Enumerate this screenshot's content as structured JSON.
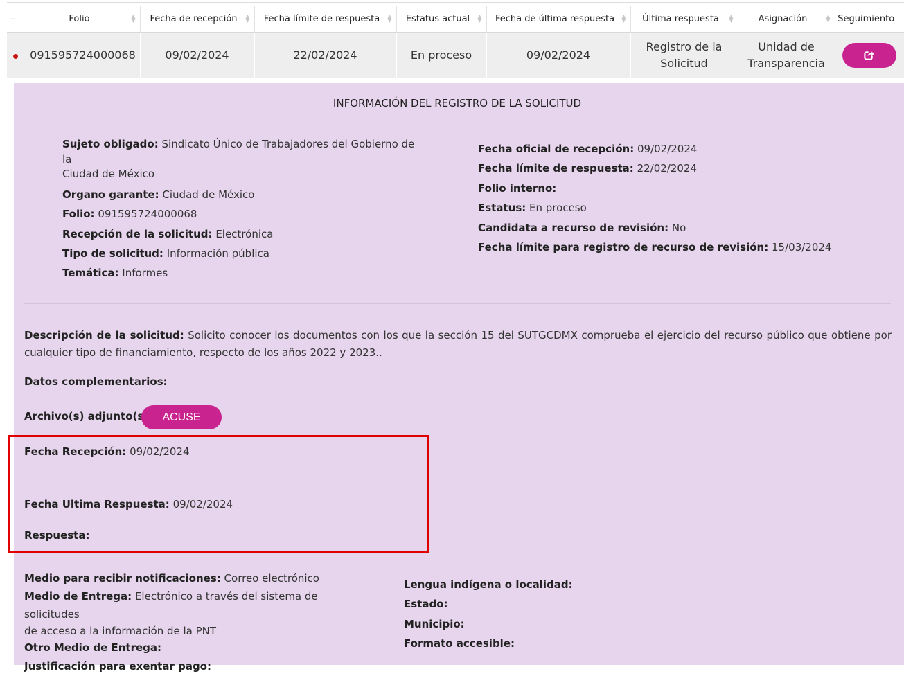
{
  "table": {
    "headers": [
      "--",
      "Folio",
      "Fecha de recepción",
      "Fecha límite de respuesta",
      "Estatus actual",
      "Fecha de última respuesta",
      "Última respuesta",
      "Asignación",
      "Seguimiento"
    ],
    "row": {
      "folio": "091595724000068",
      "fecha_recepcion": "09/02/2024",
      "fecha_limite": "22/02/2024",
      "estatus": "En proceso",
      "fecha_ultima": "09/02/2024",
      "ultima_respuesta_1": "Registro de la",
      "ultima_respuesta_2": "Solicitud",
      "asignacion_1": "Unidad de",
      "asignacion_2": "Transparencia",
      "seguimiento_icon": "external-link-icon"
    }
  },
  "panel": {
    "title": "INFORMACIÓN DEL REGISTRO DE LA SOLICITUD",
    "left": [
      {
        "label": "Sujeto obligado:",
        "value": "Sindicato Único de Trabajadores del Gobierno de la"
      },
      {
        "label": "",
        "value": "Ciudad de México"
      },
      {
        "label": "Organo garante:",
        "value": "Ciudad de México"
      },
      {
        "label": "Folio:",
        "value": "091595724000068"
      },
      {
        "label": "Recepción de la solicitud:",
        "value": "Electrónica"
      },
      {
        "label": "Tipo de solicitud:",
        "value": "Información pública"
      },
      {
        "label": "Temática:",
        "value": "Informes"
      }
    ],
    "right": [
      {
        "label": "Fecha oficial de recepción:",
        "value": "09/02/2024"
      },
      {
        "label": "Fecha límite de respuesta:",
        "value": "22/02/2024"
      },
      {
        "label": "Folio interno:",
        "value": ""
      },
      {
        "label": "Estatus:",
        "value": "En proceso"
      },
      {
        "label": "Candidata a recurso de revisión:",
        "value": "No"
      },
      {
        "label": "Fecha límite para registro de recurso de revisión:",
        "value": "15/03/2024"
      }
    ],
    "descripcion_label": "Descripción de la solicitud:",
    "descripcion_line1": "Solicito conocer los documentos con los que la sección 15 del SUTGCDMX comprueba el ejercicio del recurso público que obtiene por",
    "descripcion_line2": "cualquier tipo de financiamiento, respecto de los años 2022 y 2023..",
    "datos_label": "Datos complementarios:",
    "archivos_label": "Archivo(s) adjunto(s):",
    "acuse_button": "ACUSE",
    "fecha_recepcion_label": "Fecha Recepción:",
    "fecha_recepcion_value": "09/02/2024",
    "fecha_ultima_label": "Fecha Ultima Respuesta:",
    "fecha_ultima_value": "09/02/2024",
    "respuesta_label": "Respuesta:",
    "bottom_left": [
      {
        "label": "Medio para recibir notificaciones:",
        "value": "Correo electrónico"
      },
      {
        "label": "Medio de Entrega:",
        "value": "Electrónico a través del sistema de solicitudes"
      },
      {
        "label": "",
        "value": "de acceso a la información de la PNT"
      },
      {
        "label": "Otro Medio de Entrega:",
        "value": ""
      },
      {
        "label": "Justificación para exentar pago:",
        "value": ""
      }
    ],
    "bottom_right": [
      {
        "label": "Lengua indígena o localidad:",
        "value": ""
      },
      {
        "label": "Estado:",
        "value": ""
      },
      {
        "label": "Municipio:",
        "value": ""
      },
      {
        "label": "Formato accesible:",
        "value": ""
      }
    ]
  },
  "colors": {
    "accent": "#c8238f",
    "panel": "#e6d5ec",
    "highlight": "#e00000",
    "status_dot": "#cc1111"
  }
}
